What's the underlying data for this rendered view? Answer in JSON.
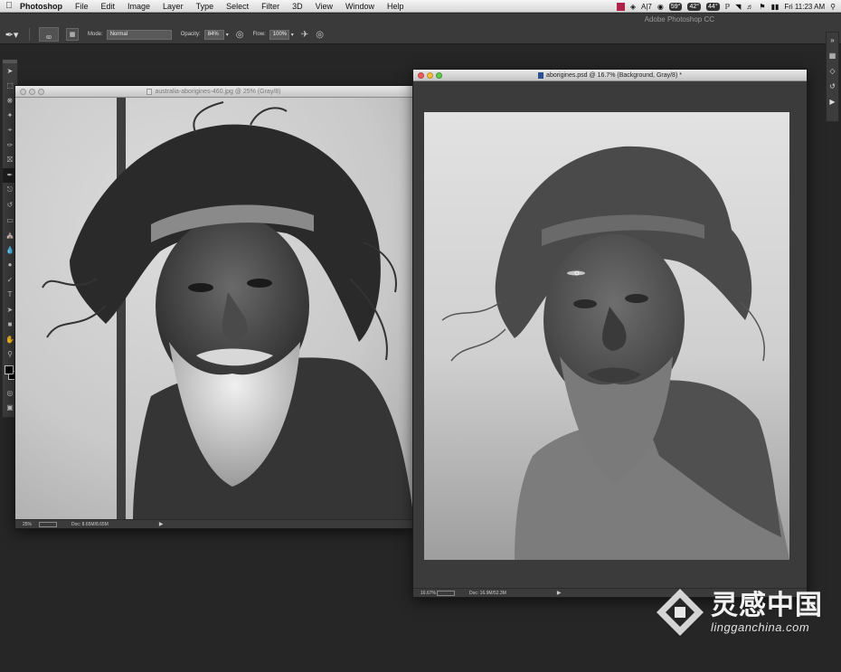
{
  "menubar": {
    "app": "Photoshop",
    "items": [
      "File",
      "Edit",
      "Image",
      "Layer",
      "Type",
      "Select",
      "Filter",
      "3D",
      "View",
      "Window",
      "Help"
    ],
    "status": {
      "ai_badge": "A|7",
      "temp1": "59°",
      "temp2": "42°",
      "temp3": "44°",
      "clock": "Fri 11:23 AM"
    }
  },
  "optbar": {
    "app_title": "Adobe Photoshop CC",
    "brush_size": "60",
    "mode_label": "Mode:",
    "mode_value": "Normal",
    "opacity_label": "Opacity:",
    "opacity_value": "84%",
    "flow_label": "Flow:",
    "flow_value": "100%"
  },
  "left_doc": {
    "title": "australia-aborigines-460.jpg @ 25% (Gray/8)",
    "zoom": "25%",
    "doc_size": "Doc: 8.65M/8.65M"
  },
  "right_doc": {
    "title": "aborigines.psd @ 16.7% (Background, Gray/8) *",
    "zoom": "16.67%",
    "doc_size": "Doc: 16.9M/52.3M"
  },
  "watermark": {
    "cn": "灵感中国",
    "en": "lingganchina.com"
  }
}
